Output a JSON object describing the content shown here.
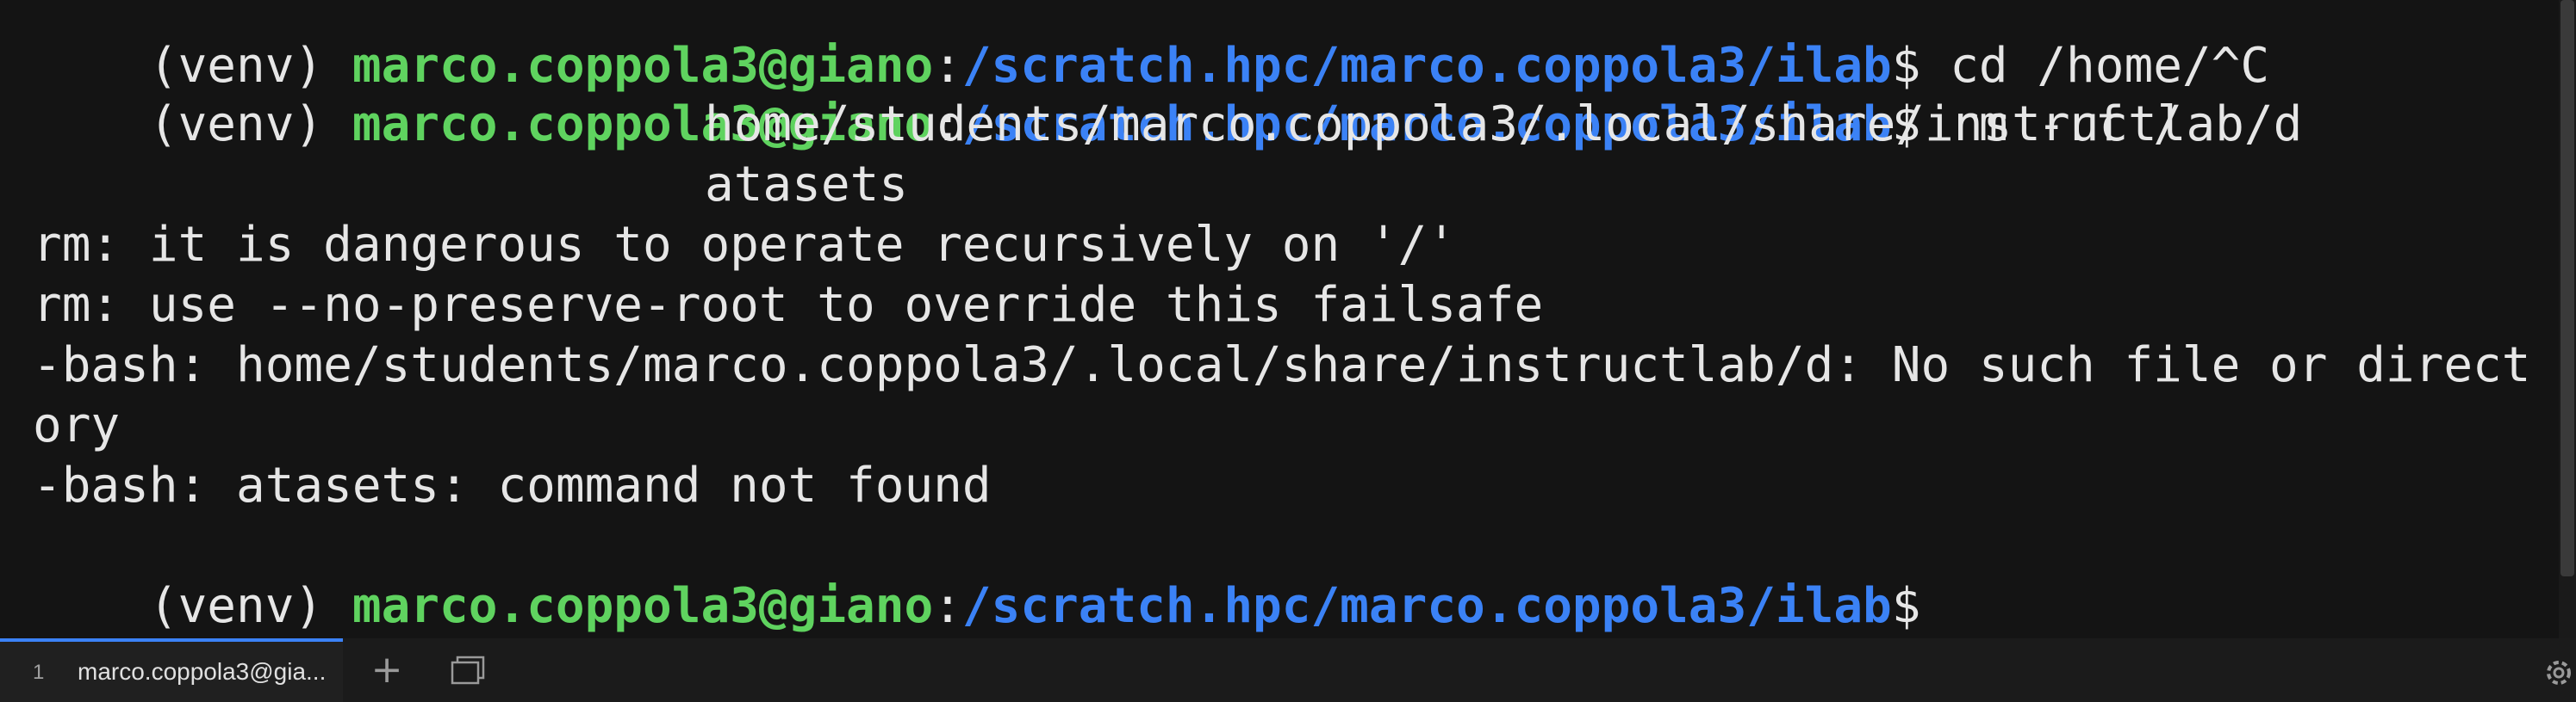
{
  "terminal": {
    "line0": {
      "prefix": "(venv) ",
      "user_host": "marco.coppola3@giano",
      "colon": ":",
      "path": "/scratch.hpc/marco.coppola3/ilab",
      "cmd": "$ cd /home/^C"
    },
    "line1": {
      "prefix": "(venv) ",
      "user_host": "marco.coppola3@giano",
      "colon": ":",
      "path": "/scratch.hpc/marco.coppola3/ilab",
      "cmd": "$ rm -rf /"
    },
    "line2": "home/students/marco.coppola3/.local/share/instructlab/d",
    "line3": "atasets",
    "line4": "rm: it is dangerous to operate recursively on '/'",
    "line5": "rm: use --no-preserve-root to override this failsafe",
    "line6": "-bash: home/students/marco.coppola3/.local/share/instructlab/d: No such file or direct",
    "line7": "ory",
    "line8": "-bash: atasets: command not found",
    "line9": {
      "prefix": "(venv) ",
      "user_host": "marco.coppola3@giano",
      "colon": ":",
      "path": "/scratch.hpc/marco.coppola3/ilab",
      "cmd": "$"
    }
  },
  "tabbar": {
    "tab1_number": "1",
    "tab1_label": "marco.coppola3@gia...",
    "new_tab_icon": "plus-icon",
    "windows_icon": "windows-icon",
    "settings_icon": "gear-icon"
  },
  "colors": {
    "background": "#141414",
    "user_host": "#5fd35f",
    "path": "#3b82f6",
    "text": "#e6e6e6",
    "active_tab_accent": "#3b82f6"
  }
}
